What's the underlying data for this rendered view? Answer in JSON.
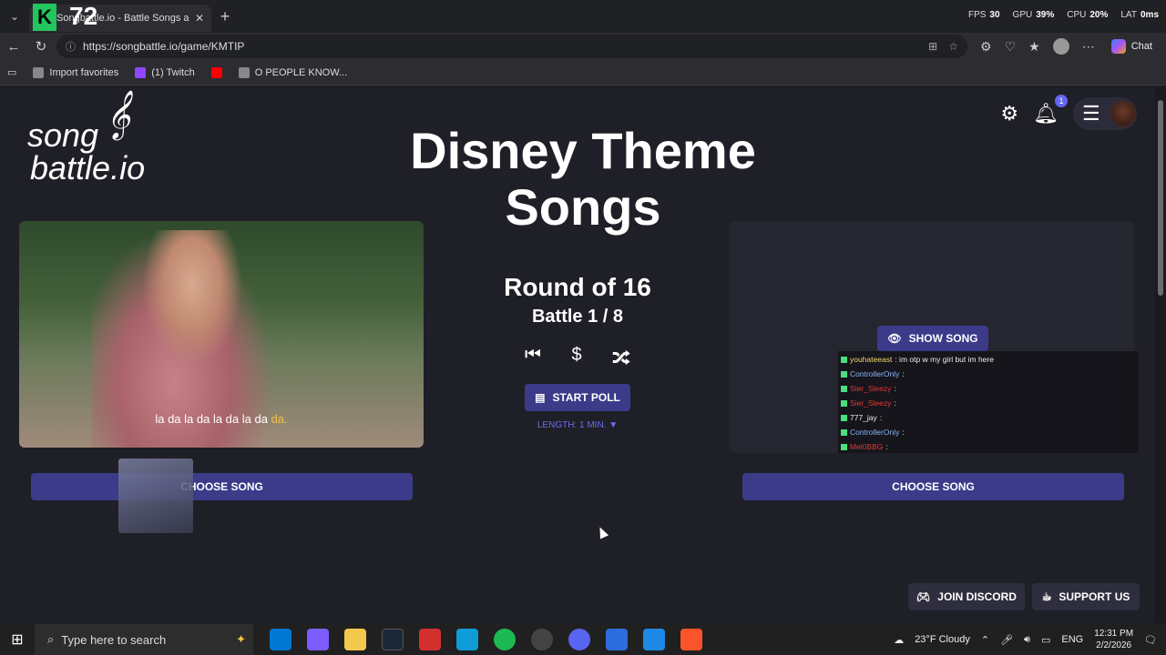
{
  "browser": {
    "tab_title": "Songbattle.io - Battle Songs a",
    "overlay_counter": "72",
    "perf": [
      {
        "label": "FPS",
        "value": "30"
      },
      {
        "label": "GPU",
        "value": "39%"
      },
      {
        "label": "CPU",
        "value": "20%"
      },
      {
        "label": "LAT",
        "value": "0ms"
      }
    ],
    "url": "https://songbattle.io/game/KMTIP",
    "chat_label": "Chat",
    "favorites": [
      {
        "label": "Import favorites",
        "color": "#888888"
      },
      {
        "label": "(1) Twitch",
        "color": "#9146ff"
      },
      {
        "label": "",
        "color": "#ff0000"
      },
      {
        "label": "O PEOPLE KNOW...",
        "color": "#888888"
      }
    ]
  },
  "page": {
    "logo_line1": "song",
    "logo_line2": "battle.io",
    "title": "Disney Theme Songs",
    "notification_count": "1",
    "round": "Round of 16",
    "battle": "Battle 1 / 8",
    "start_poll": "START POLL",
    "length": "LENGTH: 1 MIN. ▼",
    "subtitle_main": "la da la da la da la da ",
    "subtitle_highlight": "da.",
    "show_song": "SHOW SONG",
    "choose_song_left": "CHOOSE SONG",
    "choose_song_right": "CHOOSE SONG",
    "join_discord": "JOIN DISCORD",
    "support_us": "SUPPORT US",
    "chat": [
      {
        "user": "youhateeast",
        "user_color": "#f5d76e",
        "msg": ": im otp w my girl but im here"
      },
      {
        "user": "ControllerOnly",
        "user_color": "#8ab4f8",
        "msg": ":"
      },
      {
        "user": "Sier_Sleezy",
        "user_color": "#e53935",
        "msg": ":"
      },
      {
        "user": "Sier_Sleezy",
        "user_color": "#e53935",
        "msg": ":"
      },
      {
        "user": "777_jay",
        "user_color": "#eeeeee",
        "msg": ":"
      },
      {
        "user": "ControllerOnly",
        "user_color": "#8ab4f8",
        "msg": ":"
      },
      {
        "user": "Mel0BBG",
        "user_color": "#e53935",
        "msg": ":"
      }
    ]
  },
  "taskbar": {
    "search_placeholder": "Type here to search",
    "weather": "23°F  Cloudy",
    "lang": "ENG",
    "time": "12:31 PM",
    "date": "2/2/2026",
    "apps": [
      {
        "name": "store",
        "color": "#0078d4"
      },
      {
        "name": "copilot",
        "color": "#7c5cff"
      },
      {
        "name": "explorer",
        "color": "#f2c94c"
      },
      {
        "name": "steam",
        "color": "#1b2838"
      },
      {
        "name": "wps",
        "color": "#d32f2f"
      },
      {
        "name": "edge",
        "color": "#0f9bd7"
      },
      {
        "name": "spotify",
        "color": "#1db954"
      },
      {
        "name": "obs",
        "color": "#444444"
      },
      {
        "name": "discord",
        "color": "#5865f2"
      },
      {
        "name": "app-window",
        "color": "#2d6cdf"
      },
      {
        "name": "app-f",
        "color": "#1e88e5"
      },
      {
        "name": "brave",
        "color": "#fb542b"
      }
    ]
  }
}
